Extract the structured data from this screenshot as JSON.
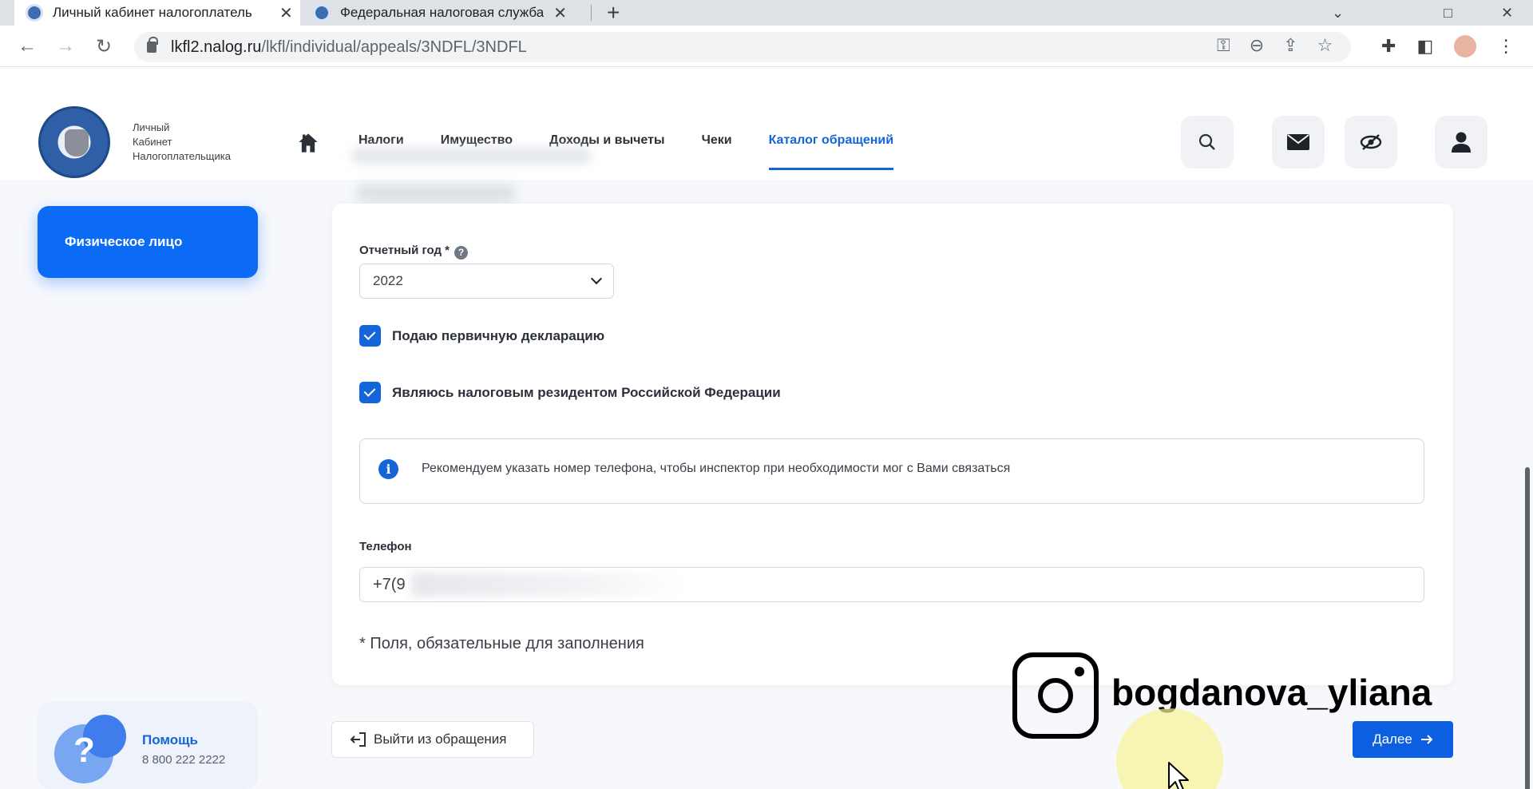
{
  "browser": {
    "tabs": [
      {
        "title": "Личный кабинет налогоплатель",
        "active": true
      },
      {
        "title": "Федеральная налоговая служба",
        "active": false
      }
    ],
    "new_tab": "+",
    "window_controls": [
      "⌄",
      "□",
      "✕"
    ],
    "url_domain": "lkfl2.nalog.ru",
    "url_path": "/lkfl/individual/appeals/3NDFL/3NDFL",
    "icons": [
      "key-icon",
      "zoom-icon",
      "share-icon",
      "star-icon",
      "puzzle-icon",
      "sidepanel-icon",
      "profile-avatar",
      "menu-icon"
    ]
  },
  "logo": {
    "line1": "Личный",
    "line2": "Кабинет",
    "line3": "Налогоплательщика"
  },
  "nav": {
    "items": [
      {
        "label": "Налоги"
      },
      {
        "label": "Имущество"
      },
      {
        "label": "Доходы и вычеты"
      },
      {
        "label": "Чеки"
      },
      {
        "label": "Каталог обращений",
        "active": true
      }
    ]
  },
  "sidebar": {
    "person_label": "Физическое лицо",
    "help_title": "Помощь",
    "help_phone": "8 800 222 2222",
    "help_symbol": "?"
  },
  "form": {
    "year_label": "Отчетный год *",
    "year_value": "2022",
    "checkbox_primary": "Подаю первичную декларацию",
    "checkbox_resident": "Являюсь налоговым резидентом Российской Федерации",
    "info_text": "Рекомендуем указать номер телефона, чтобы инспектор при необходимости мог с Вами связаться",
    "phone_label": "Телефон",
    "phone_value": "+7(9",
    "required_note": "* Поля, обязательные для заполнения"
  },
  "buttons": {
    "exit": "Выйти из обращения",
    "next": "Далее"
  },
  "overlay": {
    "instagram_handle": "bogdanova_yliana"
  },
  "colors": {
    "accent": "#1466d8",
    "primary_button": "#0c5fe0",
    "sidebar_button": "#0c6bf5"
  }
}
